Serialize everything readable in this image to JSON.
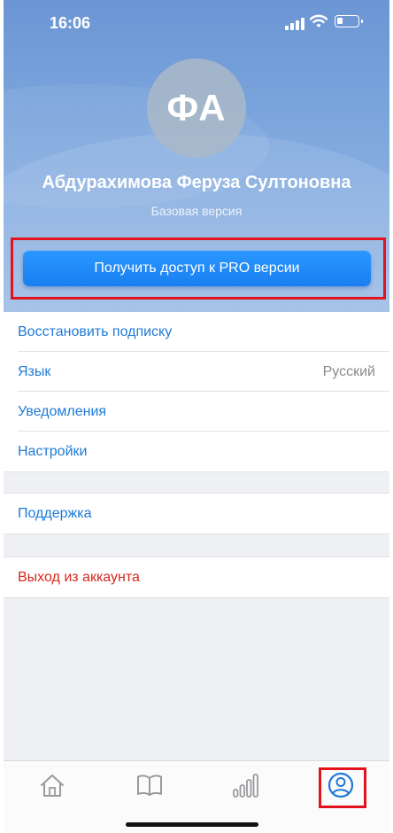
{
  "status_bar": {
    "time": "16:06"
  },
  "profile": {
    "initials": "ФА",
    "name": "Абдурахимова Феруза Султоновна",
    "plan": "Базовая версия"
  },
  "pro_button": {
    "label": "Получить доступ к PRO версии"
  },
  "settings": {
    "restore_subscription": "Восстановить подписку",
    "language_label": "Язык",
    "language_value": "Русский",
    "notifications": "Уведомления",
    "settings": "Настройки"
  },
  "support": {
    "label": "Поддержка"
  },
  "logout": {
    "label": "Выход из аккаунта"
  },
  "tabbar": {
    "items": [
      {
        "icon": "home-icon"
      },
      {
        "icon": "book-icon"
      },
      {
        "icon": "stats-icon"
      },
      {
        "icon": "profile-icon",
        "active": true
      }
    ]
  },
  "colors": {
    "accent": "#1f7ad6",
    "pro_button": "#1a87f5",
    "danger": "#d9261c",
    "highlight": "#e2131f",
    "inactive_icon": "#9a9a9e"
  }
}
